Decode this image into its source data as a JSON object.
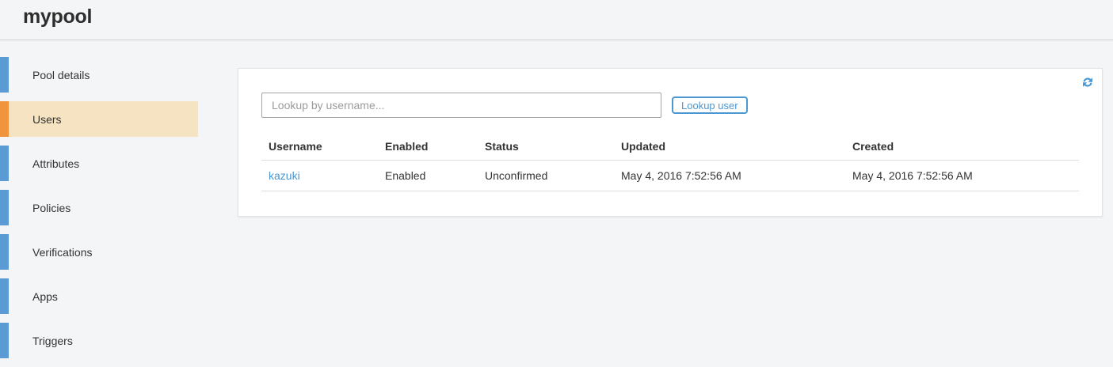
{
  "app": {
    "title": "mypool"
  },
  "sidebar": {
    "items": [
      {
        "label": "Pool details",
        "selected": false
      },
      {
        "label": "Users",
        "selected": true
      },
      {
        "label": "Attributes",
        "selected": false
      },
      {
        "label": "Policies",
        "selected": false
      },
      {
        "label": "Verifications",
        "selected": false
      },
      {
        "label": "Apps",
        "selected": false
      },
      {
        "label": "Triggers",
        "selected": false
      }
    ]
  },
  "main": {
    "lookup": {
      "placeholder": "Lookup by username...",
      "value": "",
      "button_label": "Lookup user"
    },
    "refresh_icon": "refresh-icon",
    "table": {
      "columns": [
        "Username",
        "Enabled",
        "Status",
        "Updated",
        "Created"
      ],
      "rows": [
        {
          "username": "kazuki",
          "enabled": "Enabled",
          "status": "Unconfirmed",
          "updated": "May 4, 2016 7:52:56 AM",
          "created": "May 4, 2016 7:52:56 AM"
        }
      ]
    }
  },
  "colors": {
    "page_bg": "#f4f5f6",
    "accent_blue": "#4a97d2",
    "sidebar_bar_blue": "#5b9bd3",
    "selected_bar_orange": "#f0953e",
    "selected_bg_tan": "#f5e3c2",
    "link_blue": "#4a97d2",
    "border_gray": "#dddddd"
  }
}
